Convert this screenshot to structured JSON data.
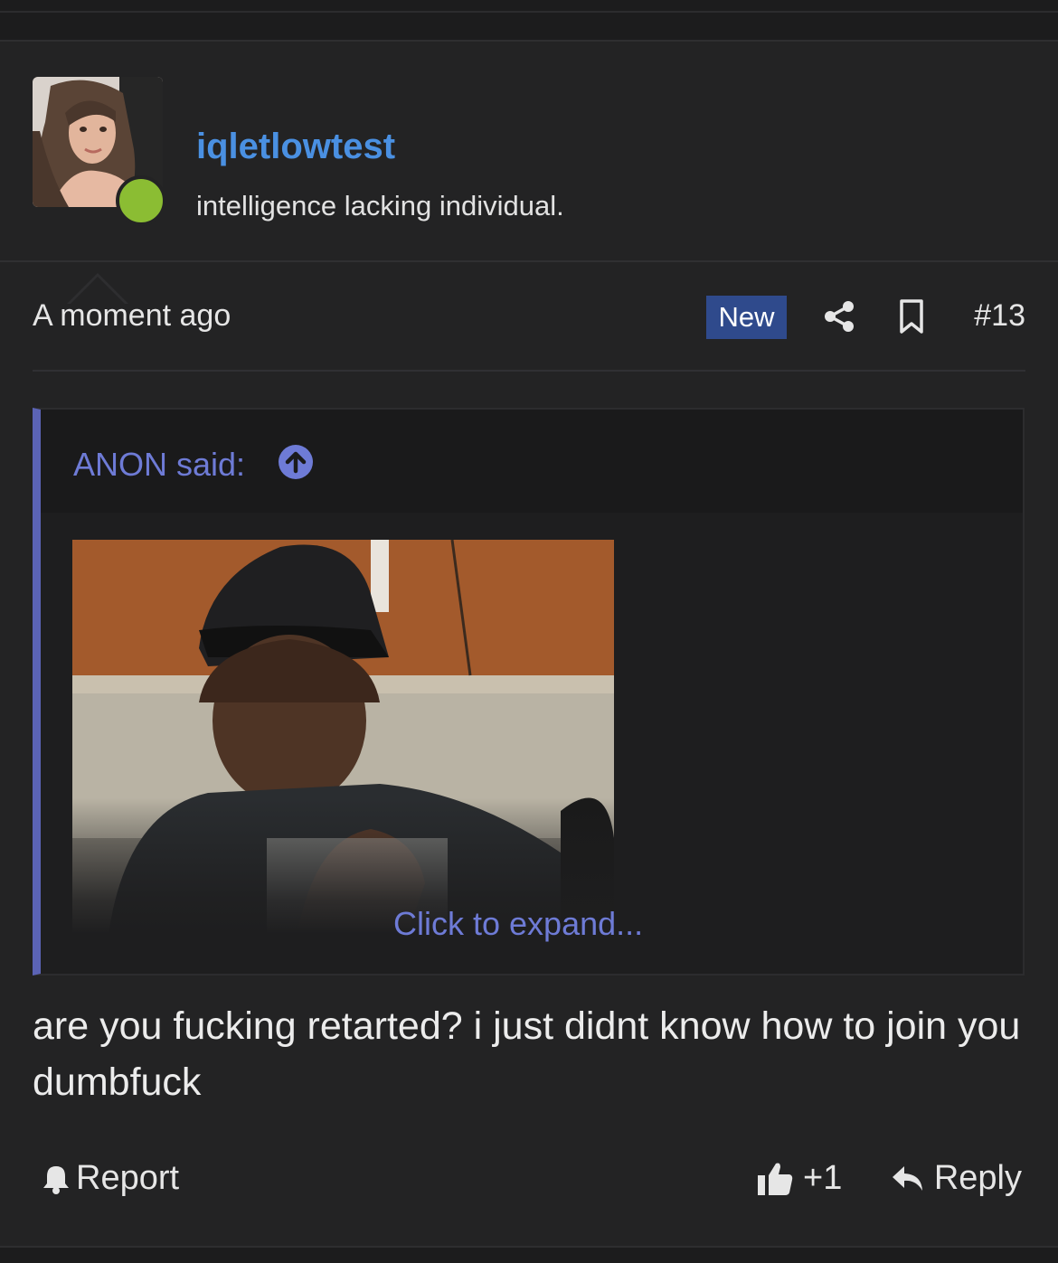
{
  "post": {
    "username": "iqletlowtest",
    "user_title": "intelligence lacking individual.",
    "timestamp": "A moment ago",
    "badge": "New",
    "post_number": "#13",
    "body": "are you fucking retarted? i just didnt know how to join you dumbfuck"
  },
  "quote": {
    "author_line": "ANON said:",
    "expand_label": "Click to expand..."
  },
  "actions": {
    "report_label": "Report",
    "like_count": "+1",
    "reply_label": "Reply"
  },
  "colors": {
    "background": "#232324",
    "username": "#4a90e2",
    "online": "#8bbd33",
    "new_badge": "#2f4a8c",
    "quote_accent": "#5b63b5",
    "quote_link": "#6e7bd6"
  },
  "icons": {
    "avatar": "avatar-photo",
    "online": "online-status-icon",
    "share": "share-icon",
    "bookmark": "bookmark-icon",
    "quote_up": "arrow-up-circle-icon",
    "report": "bell-icon",
    "like": "thumbs-up-icon",
    "reply": "reply-arrow-icon"
  }
}
